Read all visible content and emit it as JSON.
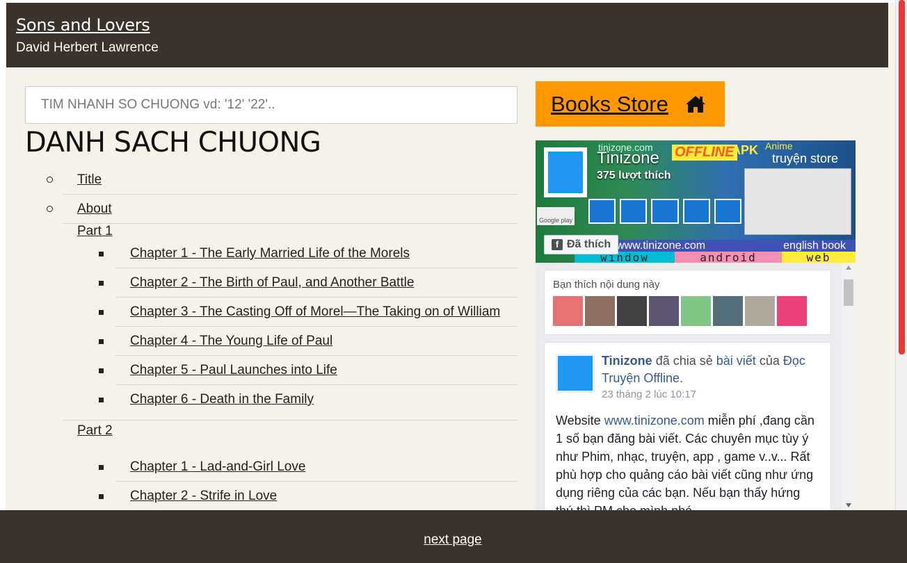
{
  "header": {
    "book_title": "Sons and Lovers",
    "author": "David Herbert Lawrence"
  },
  "search": {
    "placeholder": "TIM NHANH SO CHUONG vd: '12' '22'.."
  },
  "list_title": "DANH SACH CHUONG",
  "toc": {
    "title": "Title",
    "about": "About",
    "part1": {
      "label": "Part 1",
      "chapters": [
        "Chapter 1 - The Early Married Life of the Morels",
        "Chapter 2 - The Birth of Paul, and Another Battle",
        "Chapter 3 - The Casting Off of Morel—The Taking on of William",
        "Chapter 4 - The Young Life of Paul",
        "Chapter 5 - Paul Launches into Life",
        "Chapter 6 - Death in the Family"
      ]
    },
    "part2": {
      "label": "Part 2",
      "chapters": [
        "Chapter 1 - Lad-and-Girl Love",
        "Chapter 2 - Strife in Love"
      ]
    }
  },
  "store": {
    "label": "Books Store"
  },
  "fb": {
    "cover": {
      "site_mark": "tinizone.com",
      "offline": "OFFLINE",
      "apk": "APK",
      "anime": "Anime",
      "truyen": "truyện store",
      "page_name": "Tinizone",
      "likes": "375 lượt thích",
      "google_play": "Google play",
      "liked_button": "Đã thích",
      "site_bar": "www.tinizone.com",
      "english": "english book",
      "tag_window": "window",
      "tag_android": "android",
      "tag_web": "web"
    },
    "like_card": {
      "caption": "Bạn thích nội dung này"
    },
    "post": {
      "author": "Tinizone",
      "shared": "đã chia sẻ",
      "post_link": "bài viết",
      "of": "của",
      "source": "Đọc Truyện Offline",
      "time": "23 tháng 2 lúc 10:17",
      "body_1": "Website ",
      "body_link": "www.tinizone.com",
      "body_2": " miễn phí ,đang cần 1 số bạn đăng bài viết. Các chuyên mục tùy ý như Phim, nhạc, truyện, app , game v..v... Rất phù hợp cho quảng cáo bài viết cũng như ứng dụng riêng của các bạn. Nếu bạn thấy hứng thú thì PM cho mình nhé"
    }
  },
  "footer": {
    "next_page": "next page"
  },
  "colors": {
    "header_bg": "#3b322b",
    "page_bg": "#f5f2ea",
    "store_btn": "#ff9800",
    "scroll_thumb": "#e53935",
    "fb_link": "#365899"
  }
}
